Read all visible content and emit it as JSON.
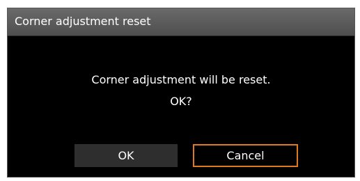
{
  "dialog": {
    "title": "Corner adjustment reset",
    "message_line1": "Corner adjustment will be reset.",
    "message_line2": "OK?",
    "ok_label": "OK",
    "cancel_label": "Cancel"
  },
  "colors": {
    "background": "#000000",
    "title_bar": "#5c5c5c",
    "button": "#2e2e2e",
    "focus_border": "#e07a1f",
    "text": "#ffffff"
  },
  "state": {
    "focused_button": "Cancel"
  }
}
